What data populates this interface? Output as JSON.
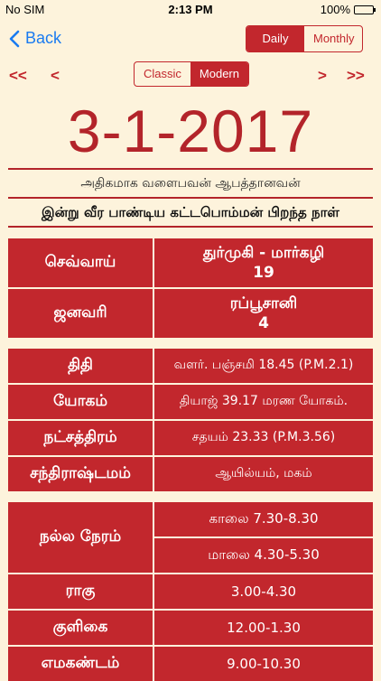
{
  "status": {
    "carrier": "No SIM",
    "time": "2:13 PM",
    "battery": "100%"
  },
  "nav": {
    "back": "Back",
    "view_tabs": [
      "Daily",
      "Monthly"
    ],
    "active_view": "Daily"
  },
  "mode": {
    "arrows": [
      "<<",
      "<",
      ">",
      ">>"
    ],
    "options": [
      "Classic",
      "Modern"
    ],
    "active": "Modern"
  },
  "date": "3-1-2017",
  "notes": {
    "line1": "அதிகமாக வளைபவன் ஆபத்தானவன்",
    "line2": "இன்று வீர பாண்டிய கட்டபொம்மன் பிறந்த நாள்"
  },
  "calendar": {
    "day_label": "செவ்வாய்",
    "tamil_month": "துர்முகி - மார்கழி",
    "tamil_day": "19",
    "month_label": "ஜனவரி",
    "islamic_month": "ரப்பூசானி",
    "islamic_day": "4"
  },
  "panchang": [
    {
      "label": "திதி",
      "value": "வளர். பஞ்சமி 18.45 (P.M.2.1)"
    },
    {
      "label": "யோகம்",
      "value": "தியாஜ் 39.17 மரண யோகம்."
    },
    {
      "label": "நட்சத்திரம்",
      "value": "சதயம் 23.33 (P.M.3.56)"
    },
    {
      "label": "சந்திராஷ்டமம்",
      "value": "ஆயில்யம், மகம்"
    }
  ],
  "timings": {
    "good_time_label": "நல்ல நேரம்",
    "morning": "காலை 7.30-8.30",
    "evening": "மாலை 4.30-5.30",
    "rows": [
      {
        "label": "ராகு",
        "value": "3.00-4.30"
      },
      {
        "label": "குளிகை",
        "value": "12.00-1.30"
      },
      {
        "label": "எமகண்டம்",
        "value": "9.00-10.30"
      }
    ]
  }
}
